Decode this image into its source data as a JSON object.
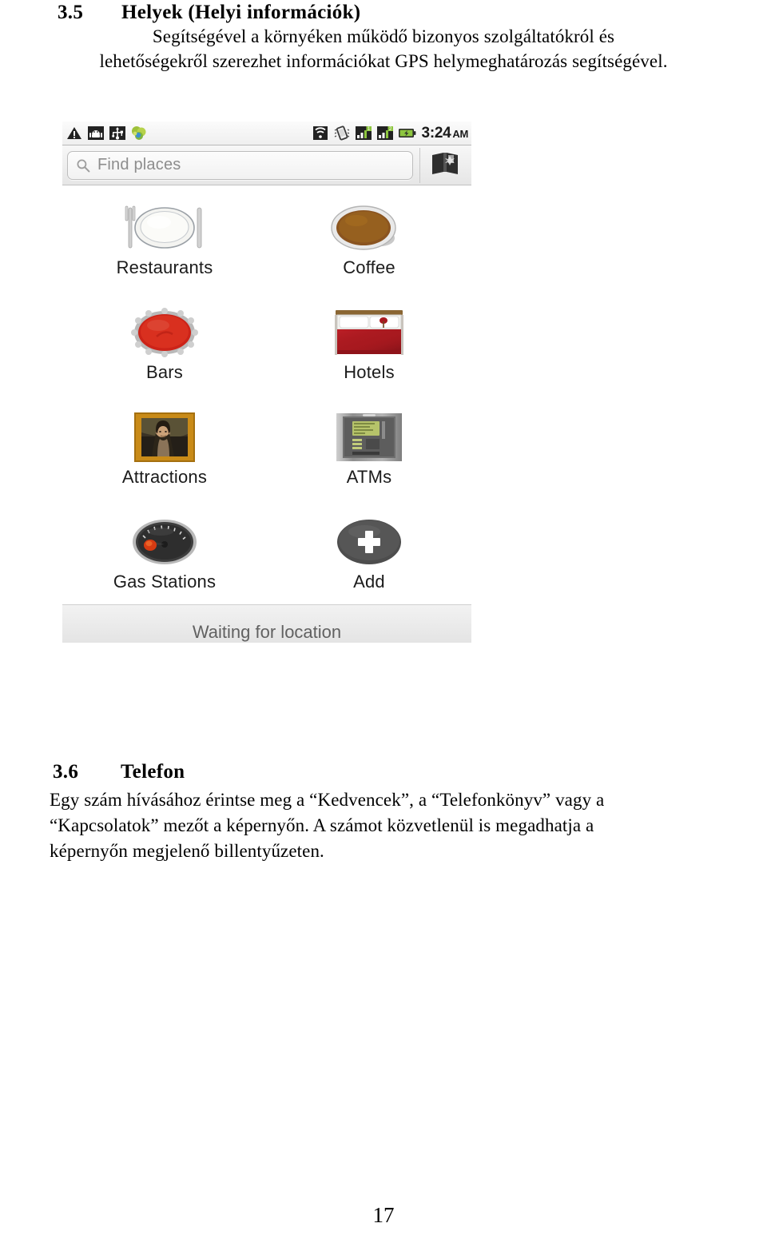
{
  "document": {
    "section_35": {
      "number": "3.5",
      "title": "Helyek (Helyi információk)",
      "body_line1": "Segítségével a környéken működő bizonyos szolgáltatókról és",
      "body_line2": "lehetőségekről szerezhet információkat GPS helymeghatározás segítségével."
    },
    "section_36": {
      "number": "3.6",
      "title": "Telefon",
      "body_line1": "Egy szám hívásához érintse meg a “Kedvencek”, a “Telefonkönyv” vagy a",
      "body_line2": "“Kapcsolatok” mezőt a képernyőn. A számot közvetlenül is megadhatja a",
      "body_line3": "képernyőn megjelenő billentyűzeten."
    },
    "page_number": "17"
  },
  "screenshot": {
    "status_bar": {
      "left_icons": [
        {
          "name": "warning-triangle-icon"
        },
        {
          "name": "android-robot-icon"
        },
        {
          "name": "usb-debug-icon"
        },
        {
          "name": "sync-blob-icon"
        }
      ],
      "right_icons": [
        {
          "name": "wifi-icon"
        },
        {
          "name": "vibrate-icon"
        },
        {
          "name": "signal-bars-sim1-icon",
          "badge": "1"
        },
        {
          "name": "signal-bars-sim2-icon",
          "badge": "2"
        },
        {
          "name": "battery-charging-icon"
        }
      ],
      "time": "3:24",
      "time_meridiem": "AM"
    },
    "search": {
      "icon": "search-icon",
      "placeholder": "Find places",
      "value": "",
      "map_button_icon": "map-book-icon"
    },
    "places": [
      {
        "label": "Restaurants",
        "icon": "plate-cutlery-icon"
      },
      {
        "label": "Coffee",
        "icon": "coffee-cup-icon"
      },
      {
        "label": "Bars",
        "icon": "bottle-cap-icon"
      },
      {
        "label": "Hotels",
        "icon": "bed-icon"
      },
      {
        "label": "Attractions",
        "icon": "framed-painting-icon"
      },
      {
        "label": "ATMs",
        "icon": "atm-machine-icon"
      },
      {
        "label": "Gas Stations",
        "icon": "fuel-gauge-icon"
      },
      {
        "label": "Add",
        "icon": "plus-circle-icon"
      }
    ],
    "status_strip": {
      "text": "Waiting for location"
    },
    "colors": {
      "coffee_brown": "#8a5420",
      "bottle_cap_red": "#cc2318",
      "bed_red": "#a8191f",
      "frame_gold": "#c98b18",
      "atm_grey": "#9a9a9a",
      "add_dark": "#4d4d4d"
    }
  }
}
